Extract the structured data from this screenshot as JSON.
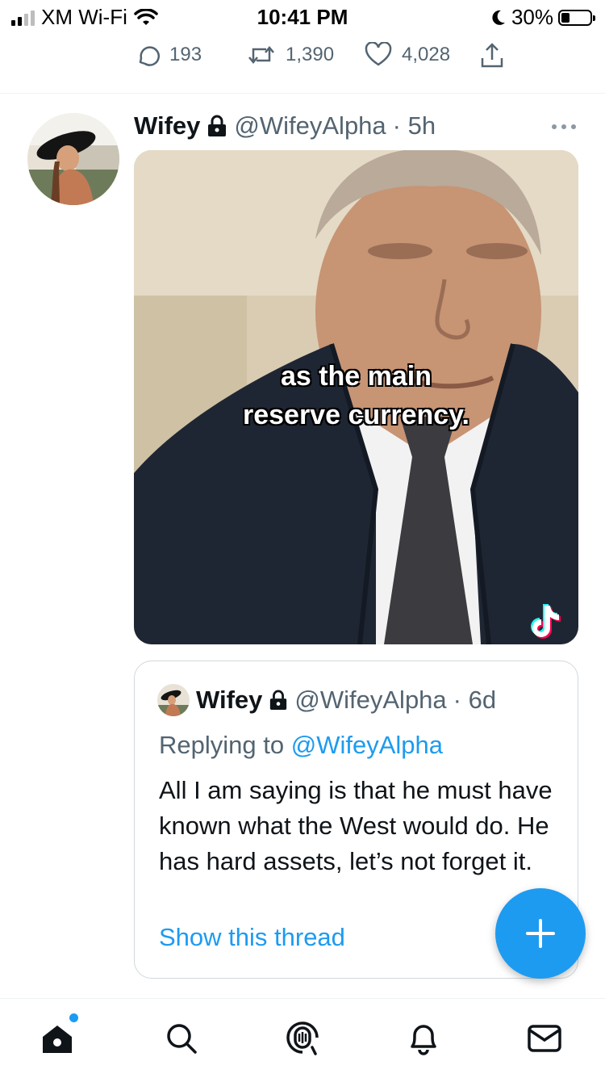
{
  "status_bar": {
    "carrier": "XM Wi-Fi",
    "time": "10:41 PM",
    "battery": "30%",
    "battery_level": 0.3
  },
  "tweet_actions": {
    "replies": "193",
    "retweets": "1,390",
    "likes": "4,028"
  },
  "tweet": {
    "author_name": "Wifey",
    "handle": "@WifeyAlpha",
    "time": "· 5h",
    "media_caption_line1": "as the main",
    "media_caption_line2": "reserve currency."
  },
  "quoted_tweet": {
    "author_name": "Wifey",
    "handle": "@WifeyAlpha",
    "time": "· 6d",
    "replying_prefix": "Replying to",
    "replying_to": "@WifeyAlpha",
    "text": "All I am saying is that he must have known what the West would do. He has hard assets, let’s not forget it.",
    "show_thread": "Show this thread"
  },
  "icons": {
    "reply": "reply-icon",
    "retweet": "retweet-icon",
    "like": "heart-icon",
    "share": "share-icon",
    "lock": "lock-icon",
    "more": "more-icon",
    "compose": "plus-icon",
    "home": "home-icon",
    "search": "search-icon",
    "spaces": "spaces-icon",
    "notifications": "bell-icon",
    "messages": "mail-icon"
  },
  "colors": {
    "accent": "#1d9bf0",
    "text": "#0f1419",
    "secondary": "#536471",
    "border": "#cfd9de"
  }
}
